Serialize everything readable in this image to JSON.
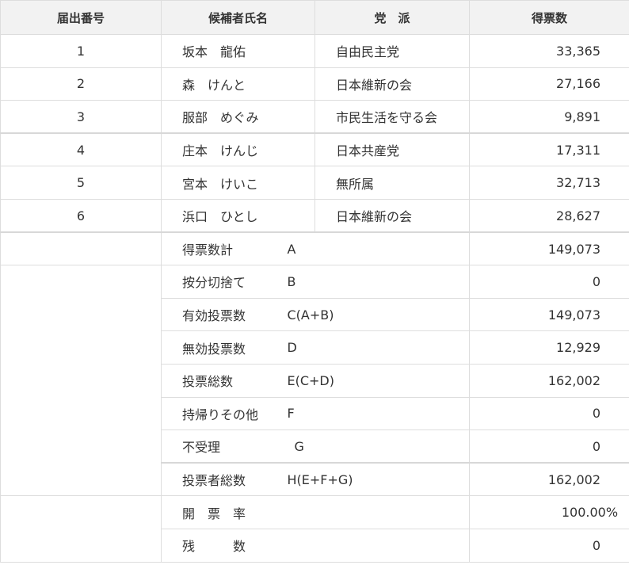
{
  "headers": {
    "number": "届出番号",
    "candidate": "候補者氏名",
    "party": "党　派",
    "votes": "得票数"
  },
  "candidates": [
    {
      "number": "1",
      "name": "坂本　龍佑",
      "party": "自由民主党",
      "votes": "33,365"
    },
    {
      "number": "2",
      "name": "森　けんと",
      "party": "日本維新の会",
      "votes": "27,166"
    },
    {
      "number": "3",
      "name": "服部　めぐみ",
      "party": "市民生活を守る会",
      "votes": "9,891"
    },
    {
      "number": "4",
      "name": "庄本　けんじ",
      "party": "日本共産党",
      "votes": "17,311"
    },
    {
      "number": "5",
      "name": "宮本　けいこ",
      "party": "無所属",
      "votes": "32,713"
    },
    {
      "number": "6",
      "name": "浜口　ひとし",
      "party": "日本維新の会",
      "votes": "28,627"
    }
  ],
  "summary": [
    {
      "label": "得票数計",
      "formula": "A",
      "value": "149,073"
    },
    {
      "label": "按分切捨て",
      "formula": "B",
      "value": "0"
    },
    {
      "label": "有効投票数",
      "formula": "C(A+B)",
      "value": "149,073"
    },
    {
      "label": "無効投票数",
      "formula": "D",
      "value": "12,929"
    },
    {
      "label": "投票総数",
      "formula": "E(C+D)",
      "value": "162,002"
    },
    {
      "label": "持帰りその他",
      "formula": "F",
      "value": "0"
    },
    {
      "label": "不受理",
      "formula": "G",
      "value": "0"
    },
    {
      "label": "投票者総数",
      "formula": "H(E+F+G)",
      "value": "162,002"
    }
  ],
  "counting": [
    {
      "label": "開　票　率",
      "value": "100.00%"
    },
    {
      "label": "残　　　数",
      "value": "0"
    }
  ]
}
